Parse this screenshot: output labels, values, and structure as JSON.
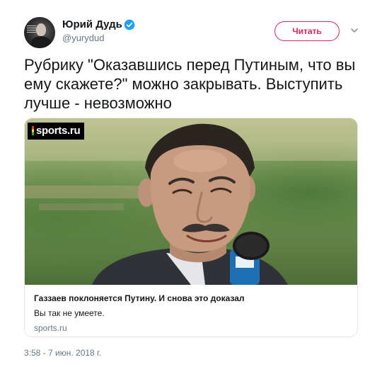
{
  "author": {
    "display_name": "Юрий Дудь",
    "handle": "@yurydud",
    "verified_icon": "verified-badge-icon",
    "avatar_icon": "avatar-photo"
  },
  "follow_button": {
    "label": "Читать",
    "color": "#e0245e"
  },
  "menu_icon": "chevron-down-icon",
  "tweet": {
    "text": "Рубрику \"Оказавшись перед Путиным, что вы ему скажете?\" можно закрывать. Выступить лучше - невозможно"
  },
  "card": {
    "image_logo": "sports.ru",
    "title": "Газзаев поклоняется Путину. И снова это доказал",
    "description": "Вы так не умеете.",
    "domain": "sports.ru"
  },
  "timestamp": "3:58 - 7 июн. 2018 г.",
  "colors": {
    "text": "#14171a",
    "secondary": "#657786",
    "verified": "#1da1f2",
    "border": "#e1e8ed"
  }
}
